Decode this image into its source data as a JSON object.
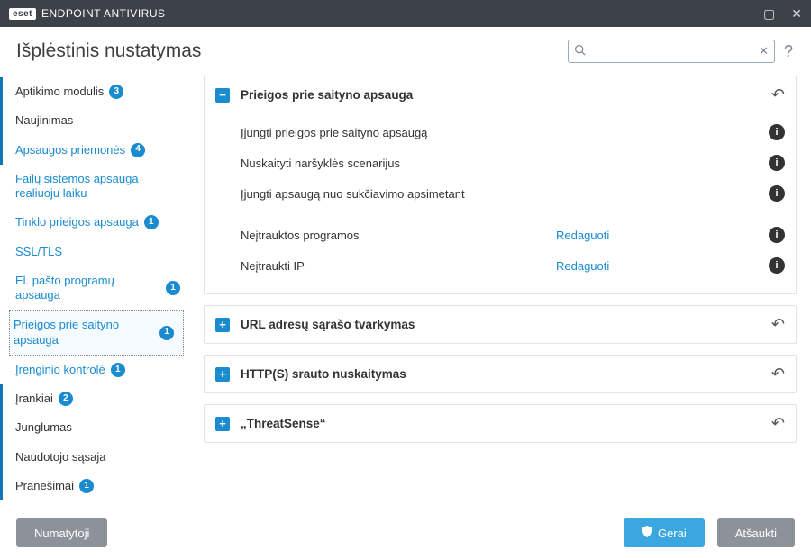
{
  "titlebar": {
    "brand_eset": "eset",
    "product": "ENDPOINT ANTIVIRUS"
  },
  "header": {
    "title": "Išplėstinis nustatymas",
    "search_placeholder": "",
    "help": "?"
  },
  "sidebar": {
    "items": [
      {
        "label": "Aptikimo modulis",
        "badge": "3"
      },
      {
        "label": "Naujinimas"
      },
      {
        "label": "Apsaugos priemonės",
        "badge": "4"
      },
      {
        "label": "Failų sistemos apsauga realiuoju laiku"
      },
      {
        "label": "Tinklo prieigos apsauga",
        "badge": "1"
      },
      {
        "label": "SSL/TLS"
      },
      {
        "label": "El. pašto programų apsauga",
        "badge": "1"
      },
      {
        "label": "Prieigos prie saityno apsauga",
        "badge": "1"
      },
      {
        "label": "Įrenginio kontrolė",
        "badge": "1"
      },
      {
        "label": "Įrankiai",
        "badge": "2"
      },
      {
        "label": "Junglumas"
      },
      {
        "label": "Naudotojo sąsaja"
      },
      {
        "label": "Pranešimai",
        "badge": "1"
      }
    ]
  },
  "panels": {
    "main": {
      "title": "Prieigos prie saityno apsauga",
      "rows": [
        {
          "label": "Įjungti prieigos prie saityno apsaugą",
          "type": "toggle",
          "on": true
        },
        {
          "label": "Nuskaityti naršyklės scenarijus",
          "type": "toggle",
          "on": true
        },
        {
          "label": "Įjungti apsaugą nuo sukčiavimo apsimetant",
          "type": "toggle",
          "on": true
        }
      ],
      "edit_rows": [
        {
          "label": "Neįtrauktos programos",
          "action": "Redaguoti"
        },
        {
          "label": "Neįtraukti IP",
          "action": "Redaguoti"
        }
      ]
    },
    "collapsed": [
      {
        "title": "URL adresų sąrašo tvarkymas"
      },
      {
        "title": "HTTP(S) srauto nuskaitymas"
      },
      {
        "title": "„ThreatSense“"
      }
    ]
  },
  "footer": {
    "defaults": "Numatytoji",
    "ok": "Gerai",
    "cancel": "Atšaukti"
  }
}
